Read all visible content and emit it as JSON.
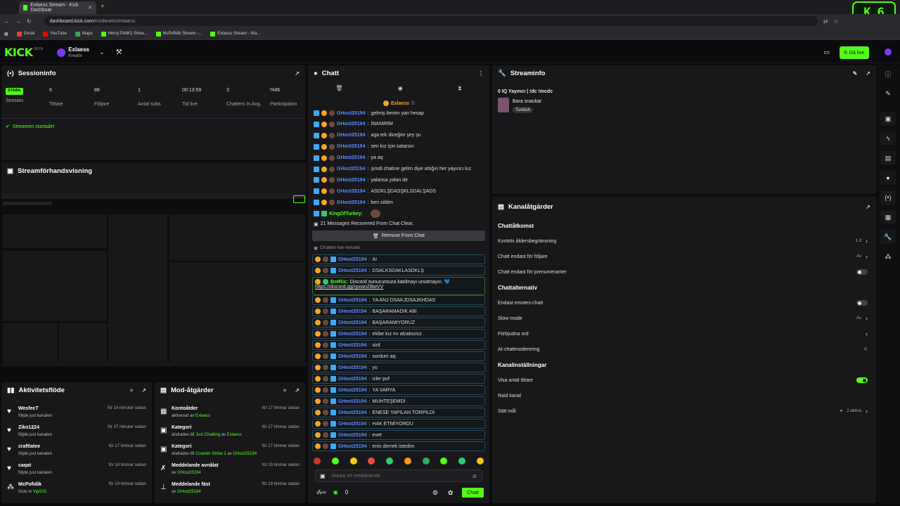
{
  "browser": {
    "tab_title": "Exlaess Stream - Kick Dashboar",
    "url_host": "dashboard.kick.com",
    "url_path": "/moderator/exlaess",
    "bookmarks": [
      "Gmail",
      "YouTube",
      "Maps",
      "HenryTANK1 Strea...",
      "McPofidik Stream -...",
      "Exlaess Stream - Wa..."
    ],
    "badge_letter": "K",
    "badge_num": "6"
  },
  "header": {
    "logo": "KICK",
    "beta": "BETA",
    "channel_name": "Exlaess",
    "channel_role": "Kreatör",
    "go_live": "Gå live"
  },
  "session": {
    "title": "Sessioninfo",
    "status_badge": "STABIL",
    "status_label": "Session",
    "stats": [
      {
        "value": "6",
        "label": "Tittare"
      },
      {
        "value": "88",
        "label": "Följare"
      },
      {
        "value": "1",
        "label": "Antal subs"
      },
      {
        "value": "00:13:59",
        "label": "Tid live"
      },
      {
        "value": "3",
        "label": "Chatters In Avg."
      },
      {
        "value": "%46",
        "label": "Participation"
      }
    ],
    "started": "Streamen startade!"
  },
  "preview": {
    "title": "Streamförhandsvisning"
  },
  "activity": {
    "title": "Aktivitetsflöde",
    "items": [
      {
        "name": "WesfecT",
        "sub": "följde just kanalen",
        "time": "för 14 minuter sedan"
      },
      {
        "name": "Ziko1224",
        "sub": "följde just kanalen",
        "time": "för 37 minuter sedan"
      },
      {
        "name": "craftlatee",
        "sub": "följde just kanalen",
        "time": "för 17 timmar sedan"
      },
      {
        "name": "caqat",
        "sub": "följde just kanalen",
        "time": "för 18 timmar sedan"
      },
      {
        "name": "McPofidik",
        "sub": "löste in",
        "sub_hl": "Vip/OG",
        "time": "för 19 timmar sedan"
      }
    ]
  },
  "modactions": {
    "title": "Mod-åtgärder",
    "items": [
      {
        "name": "Kontoåtder",
        "sub": "aktiverad av",
        "hl": "Exlaess",
        "time": "för 17 timmar sedan"
      },
      {
        "name": "Kategori",
        "sub": "ändrades till",
        "hl": "Just Chatting",
        "sub2": "av",
        "hl2": "Exlaess",
        "time": "för 17 timmar sedan"
      },
      {
        "name": "Kategori",
        "sub": "ändrades till",
        "hl": "Counter-Strike 2",
        "sub2": "av",
        "hl2": "GHost25194",
        "time": "för 17 timmar sedan"
      },
      {
        "name": "Meddelande avnålat",
        "sub": "av",
        "hl": "GHost25194",
        "time": "för 19 timmar sedan"
      },
      {
        "name": "Meddelande fäst",
        "sub": "av",
        "hl": "GHost25194",
        "time": "för 19 timmar sedan"
      }
    ]
  },
  "chat": {
    "title": "Chatt",
    "pinned_user": "Exlaess",
    "pinned_count": "3",
    "top_messages": [
      {
        "user": "GHost25194",
        "text": "gelmiş benim yan hesap"
      },
      {
        "user": "GHost25194",
        "text": "İNANIRIM"
      },
      {
        "user": "GHost25194",
        "text": "aga tek diceğim şey şu"
      },
      {
        "user": "GHost25194",
        "text": "sen kız için satarsın"
      },
      {
        "user": "GHost25194",
        "text": "ya aq"
      },
      {
        "user": "GHost25194",
        "text": "şimdi chatine gelim diye attığın her yayıncı kız"
      },
      {
        "user": "GHost25194",
        "text": "yalansa yalan de"
      },
      {
        "user": "GHost25194",
        "text": "ASDKLŞDASŞKLSDALŞADS"
      },
      {
        "user": "GHost25194",
        "text": "ben sildim"
      }
    ],
    "turkey_user": "KingOfTurkey:",
    "recovered": "21 Messages Recovered From Chat Clear.",
    "remove_btn": "Remove From Chat",
    "cleared": "Chatten har rensats",
    "cleared_messages": [
      {
        "user": "GHost25194",
        "text": "AI"
      },
      {
        "user": "GHost25194",
        "text": "DSALKSDAKLASDKLŞ"
      }
    ],
    "botrix_user": "BotRix:",
    "botrix_text": "Discord sunucumuza katılmayı unutmayın. 💙",
    "botrix_link": "https://discord.gg/rpxwnZBwVV",
    "more_messages": [
      {
        "user": "GHost25194",
        "text": "YA ANJ DSAKJDSAJKHDAS"
      },
      {
        "user": "GHost25194",
        "text": "BAŞARAMADIK ABİ"
      },
      {
        "user": "GHost25194",
        "text": "BAŞARAMIYORUZ"
      },
      {
        "user": "GHost25194",
        "text": "ekibe kız mı alcaksınız"
      },
      {
        "user": "GHost25194",
        "text": "sird"
      },
      {
        "user": "GHost25194",
        "text": "sordum aq"
      },
      {
        "user": "GHost25194",
        "text": "yo"
      },
      {
        "user": "GHost25194",
        "text": "izler pof"
      },
      {
        "user": "GHost25194",
        "text": "YA VARYA"
      },
      {
        "user": "GHost25194",
        "text": "MUHTEŞEMDİ"
      },
      {
        "user": "GHost25194",
        "text": "ENESE YAPILAN TORPİLDİ"
      },
      {
        "user": "GHost25194",
        "text": "HAK ETMİYORDU"
      },
      {
        "user": "GHost25194",
        "text": "evet"
      },
      {
        "user": "GHost25194",
        "text": "enis demek istedim"
      }
    ],
    "emote_colors": [
      "#c0392b",
      "#53fc18",
      "#f5c518",
      "#e74c3c",
      "#2ecc71",
      "#f39c12",
      "#27ae60",
      "#53fc18",
      "#2ecc71",
      "#f1c40f"
    ],
    "input_placeholder": "Skicka ett meddelande",
    "points": "0",
    "send_label": "Chatt"
  },
  "streaminfo": {
    "title": "Streaminfo",
    "stream_title": "0 IQ Yayıncı | !dc !mcdc",
    "category": "Bara snackar",
    "tag": "Turkish"
  },
  "channel_actions": {
    "title": "Kanalåtgärder",
    "sections": [
      {
        "heading": "Chattåtkomst",
        "rows": [
          {
            "label": "Kontots åldersbegränsning",
            "value": "1 d",
            "control": "chevron",
            "accent": true
          },
          {
            "label": "Chatt endast för följare",
            "value": "Av",
            "control": "chevron"
          },
          {
            "label": "Chatt endast för prenumeranter",
            "value": "",
            "control": "toggle-off"
          }
        ]
      },
      {
        "heading": "Chattalternativ",
        "rows": [
          {
            "label": "Endast emotes-chatt",
            "value": "",
            "control": "toggle-off"
          },
          {
            "label": "Slow mode",
            "value": "Av",
            "control": "chevron"
          },
          {
            "label": "Förbjudna ord",
            "value": "",
            "control": "chevron"
          },
          {
            "label": "AI-chattmoderering",
            "value": "",
            "control": "external"
          }
        ]
      },
      {
        "heading": "Kanalinställningar",
        "rows": [
          {
            "label": "Visa antal tittare",
            "value": "",
            "control": "toggle-on"
          },
          {
            "label": "Raid kanal",
            "value": "",
            "control": "none"
          },
          {
            "label": "Sätt mål",
            "value": "2 aktiva",
            "control": "chevron"
          }
        ]
      }
    ]
  },
  "colors": {
    "accent": "#53fc18",
    "panel": "#18181b",
    "bg": "#0b0b0d",
    "username": "#5b8bff"
  }
}
